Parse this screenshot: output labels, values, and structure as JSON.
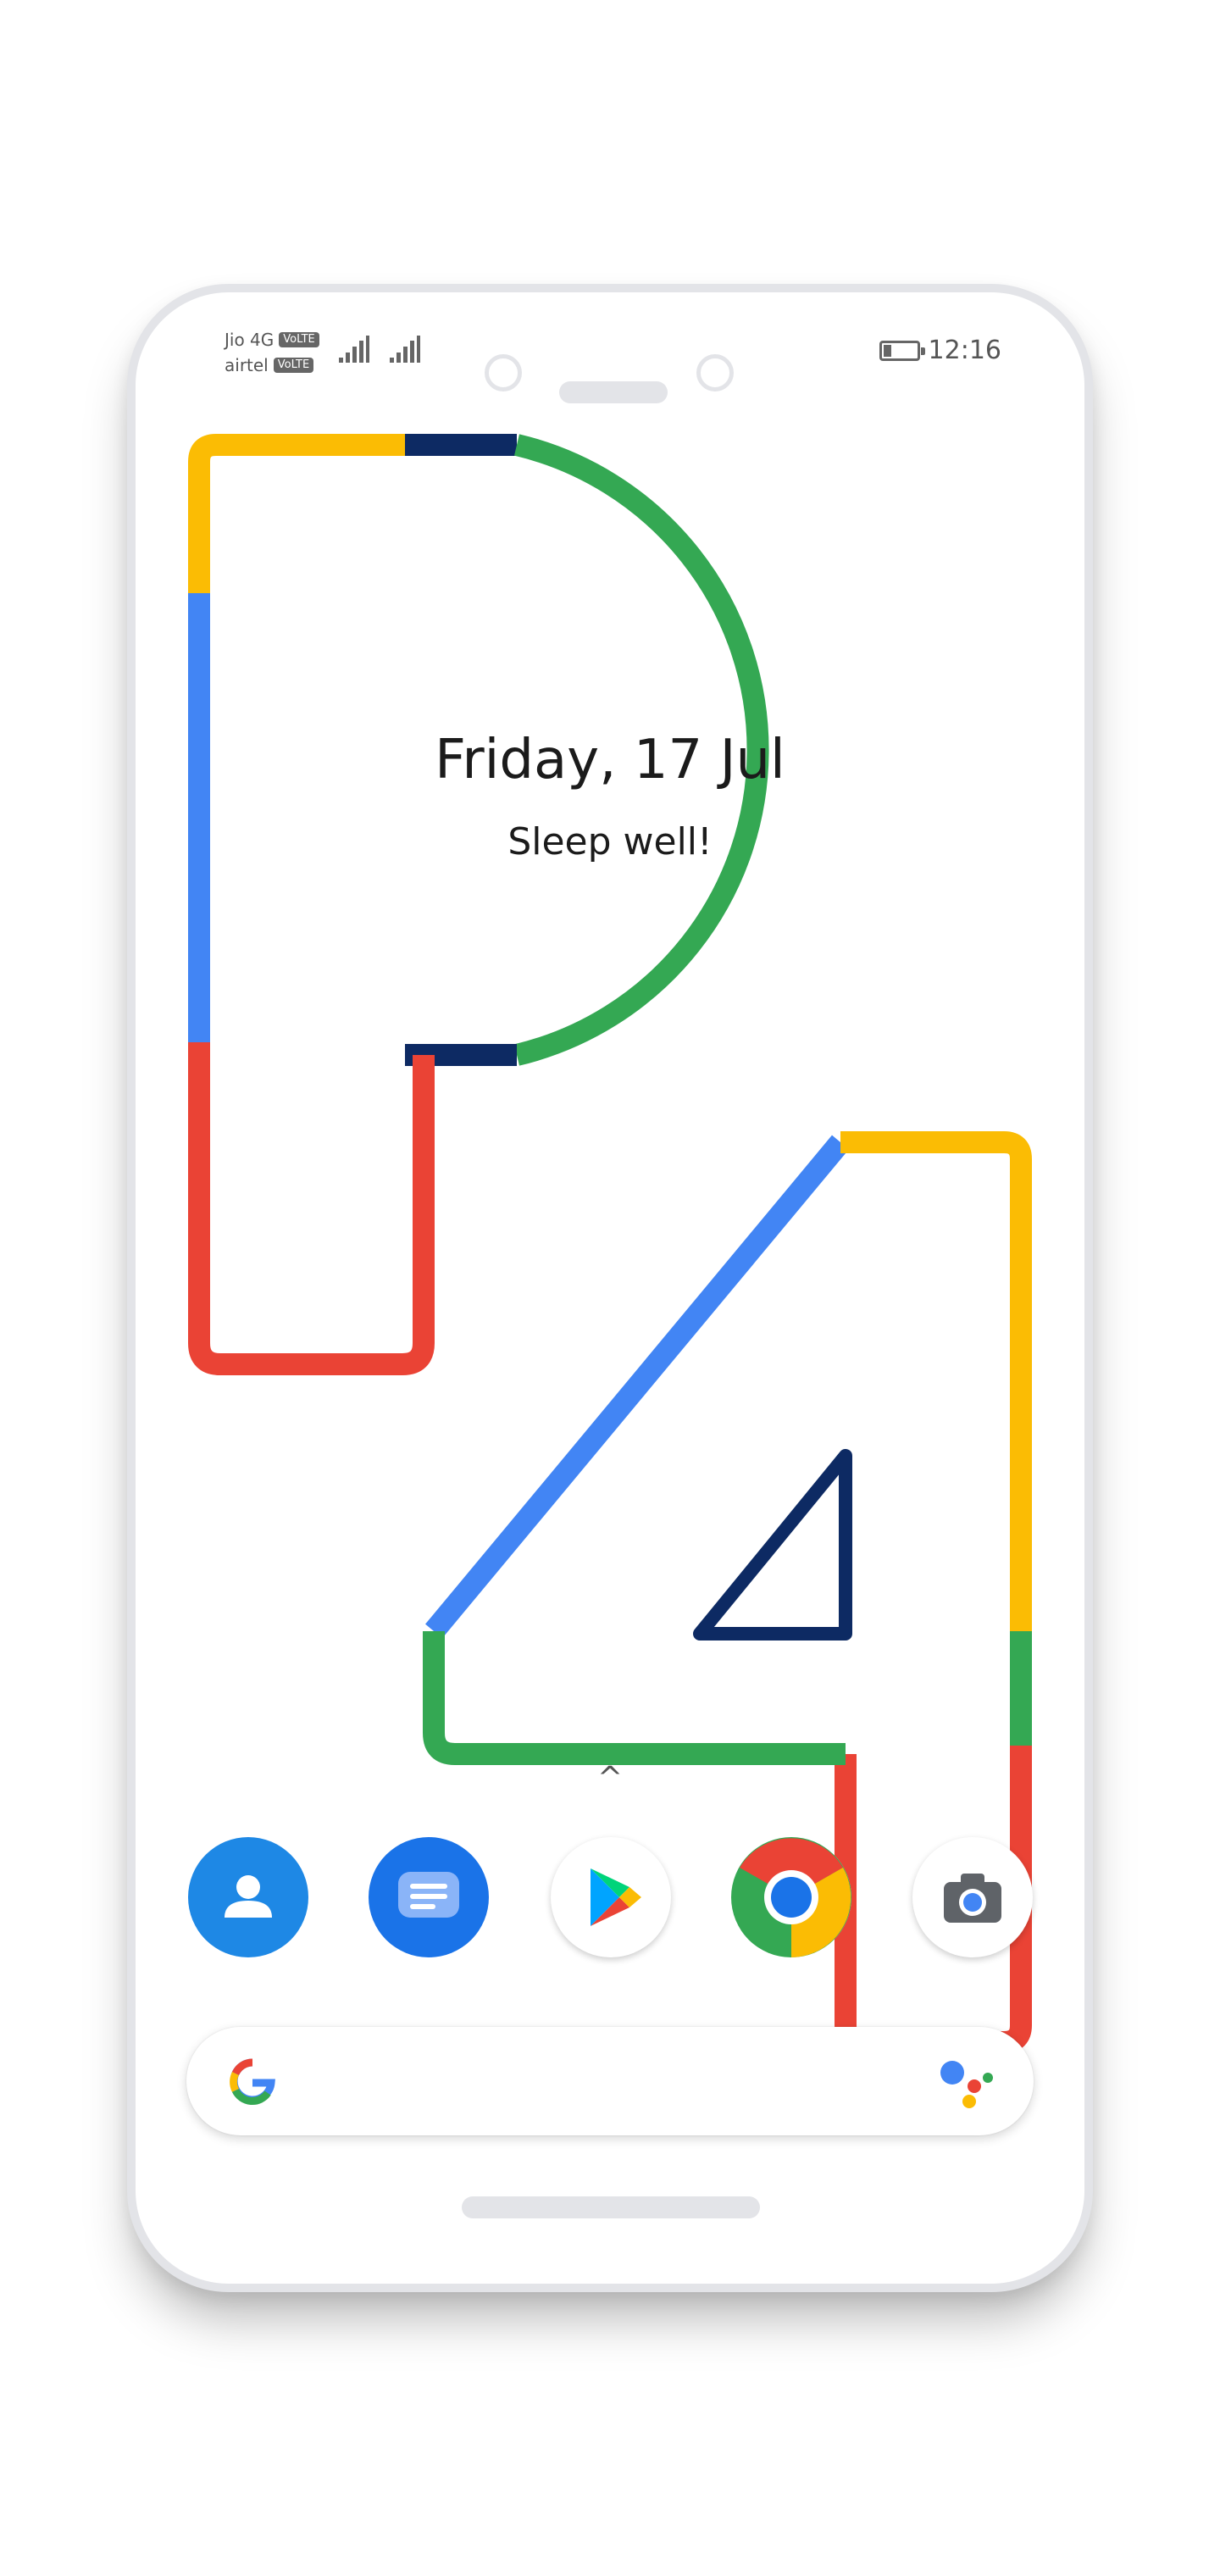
{
  "status_bar": {
    "carrier_1": "Jio 4G",
    "carrier_2": "airtel",
    "volte_badge": "VoLTE",
    "time": "12:16",
    "battery_level": 0.25
  },
  "lockscreen": {
    "date": "Friday, 17 Jul",
    "greeting": "Sleep well!",
    "swipe_up_hint": "^"
  },
  "dock": {
    "apps": [
      {
        "name": "Contacts",
        "icon": "contacts-icon",
        "color": "#1e88e5"
      },
      {
        "name": "Messages",
        "icon": "messages-icon",
        "color": "#1a73e8"
      },
      {
        "name": "Play Store",
        "icon": "play-store-icon",
        "color": "#ffffff"
      },
      {
        "name": "Chrome",
        "icon": "chrome-icon",
        "color": "#ffffff"
      },
      {
        "name": "Camera",
        "icon": "camera-icon",
        "color": "#ffffff"
      }
    ]
  },
  "search": {
    "logo": "google-g-icon",
    "assistant": "google-assistant-icon"
  },
  "colors": {
    "blue": "#4285f4",
    "red": "#ea4335",
    "yellow": "#fbbc04",
    "green": "#34a853",
    "navy": "#0d2a63"
  }
}
